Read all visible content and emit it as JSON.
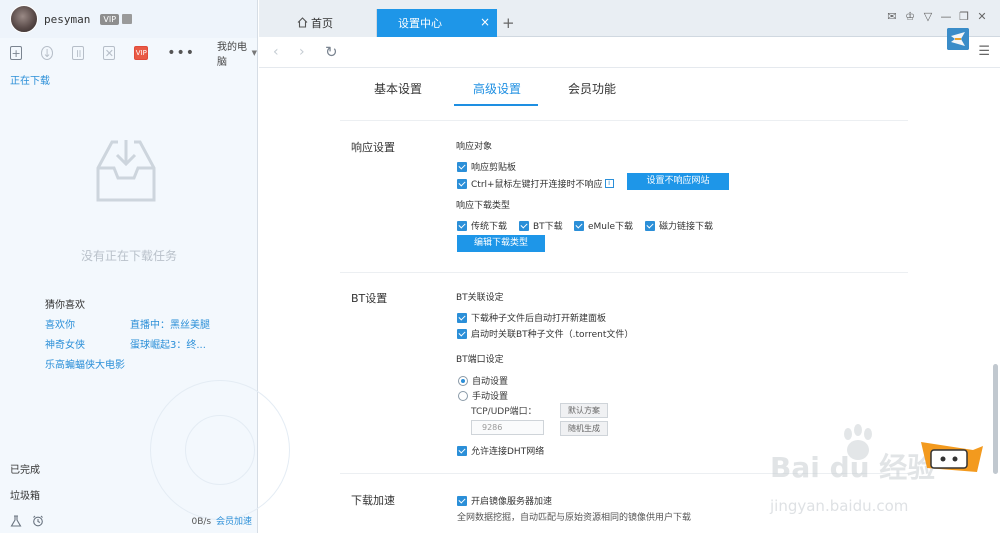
{
  "user": {
    "name": "pesyman",
    "vip": "VIP"
  },
  "toolbar": {
    "device": "我的电脑",
    "vip_label": "VIP",
    "more": "•••"
  },
  "left": {
    "downloading": "正在下载",
    "empty": "没有正在下载任务",
    "guess_title": "猜你喜欢",
    "guesses": [
      "喜欢你",
      "直播中：黑丝美腿",
      "神奇女侠",
      "蛋球崛起3：终...",
      "乐高蝙蝠侠大电影"
    ],
    "done": "已完成",
    "trash": "垃圾箱",
    "speed": "0B/s",
    "accel": "会员加速"
  },
  "tabs": {
    "home": "首页",
    "settings": "设置中心",
    "close": "×",
    "plus": "+"
  },
  "settings_tabs": [
    "基本设置",
    "高级设置",
    "会员功能"
  ],
  "response": {
    "title": "响应设置",
    "target": "响应对象",
    "clipboard": "响应剪贴板",
    "ctrl": "Ctrl+鼠标左键打开连接时不响应",
    "info": "i",
    "no_site_btn": "设置不响应网站",
    "type_title": "响应下载类型",
    "types": [
      "传统下载",
      "BT下载",
      "eMule下载",
      "磁力链接下载"
    ],
    "edit_btn": "编辑下载类型"
  },
  "bt": {
    "title": "BT设置",
    "assoc": "BT关联设定",
    "auto_open": "下载种子文件后自动打开新建面板",
    "startup_assoc": "启动时关联BT种子文件（.torrent文件）",
    "port_title": "BT端口设定",
    "auto": "自动设置",
    "manual": "手动设置",
    "port_label": "TCP/UDP端口：",
    "port_value": "9286",
    "default_btn": "默认方案",
    "random_btn": "随机生成",
    "dht": "允许连接DHT网络"
  },
  "accel": {
    "title": "下载加速",
    "mirror": "开启镜像服务器加速",
    "desc": "全网数据挖掘，自动匹配与原始资源相同的镜像供用户下载"
  },
  "watermark": {
    "main": "Bai du 经验",
    "sub": "jingyan.baidu.com"
  },
  "colors": {
    "accent": "#1e96e8",
    "link": "#2b8fd8"
  }
}
